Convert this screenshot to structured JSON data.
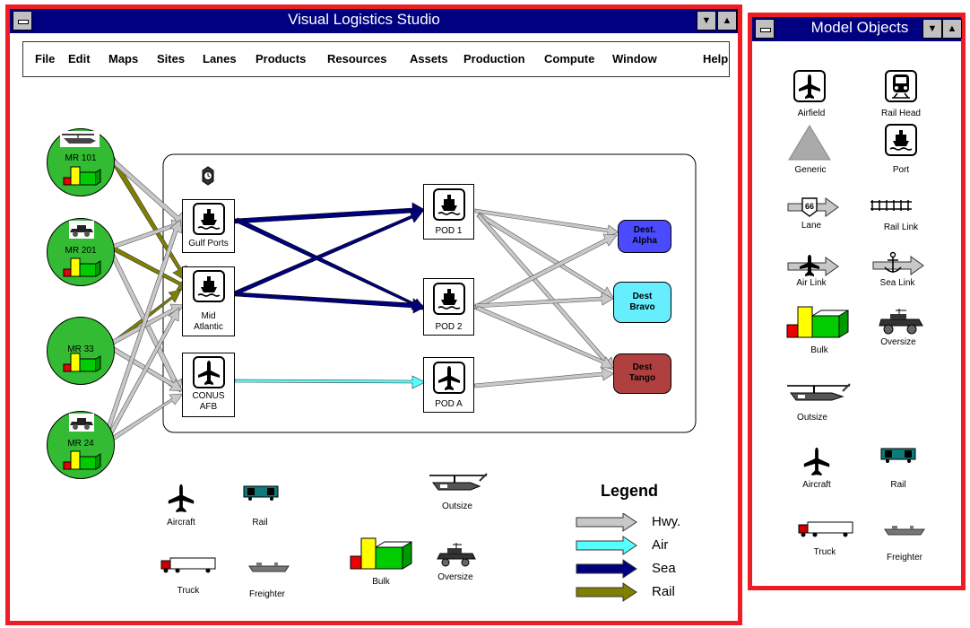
{
  "app": {
    "title": "Visual Logistics Studio",
    "menu": [
      "File",
      "Edit",
      "Maps",
      "Sites",
      "Lanes",
      "Products",
      "Resources",
      "Assets",
      "Production",
      "Compute",
      "Window",
      "Help"
    ]
  },
  "network": {
    "sources": [
      "MR  101",
      "MR 201",
      "MR 33",
      "MR 24"
    ],
    "ports": [
      {
        "line1": "Gulf Ports",
        "line2": ""
      },
      {
        "line1": "Mid",
        "line2": "Atlantic"
      },
      {
        "line1": "CONUS",
        "line2": "AFB"
      }
    ],
    "pods": [
      "POD 1",
      "POD 2",
      "POD A"
    ],
    "destinations": [
      {
        "line1": "Dest.",
        "line2": "Alpha",
        "color": "#4a4aff"
      },
      {
        "line1": "Dest",
        "line2": "Bravo",
        "color": "#66eeff"
      },
      {
        "line1": "Dest",
        "line2": "Tango",
        "color": "#b04040"
      }
    ]
  },
  "assets": [
    "Aircraft",
    "Rail",
    "Outsize",
    "Truck",
    "Freighter",
    "Bulk",
    "Oversize"
  ],
  "legend": {
    "title": "Legend",
    "items": [
      {
        "label": "Hwy.",
        "color": "#c8c8c8"
      },
      {
        "label": "Air",
        "color": "#55ffff"
      },
      {
        "label": "Sea",
        "color": "#00007f"
      },
      {
        "label": "Rail",
        "color": "#7f7f00"
      }
    ]
  },
  "palette": {
    "title": "Model Objects",
    "items": [
      "Airfield",
      "Rail Head",
      "Generic",
      "Port",
      "Lane",
      "Rail Link",
      "Air Link",
      "Sea Link",
      "Bulk",
      "Oversize",
      "Outsize",
      "Aircraft",
      "Rail",
      "Truck",
      "Freighter"
    ],
    "lane_badge": "66"
  },
  "colors": {
    "frame": "#ee1c24",
    "titlebar": "#000080",
    "source_fill": "#33bb33"
  }
}
